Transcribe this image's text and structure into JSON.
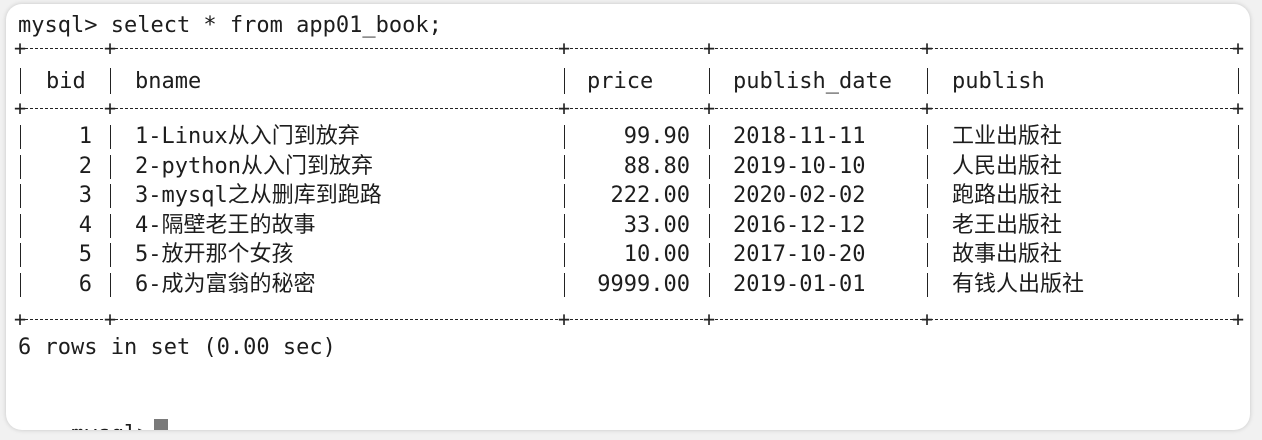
{
  "terminal": {
    "command_prompt": "mysql> select * from app01_book;",
    "prompt": "mysql>",
    "summary": "6 rows in set (0.00 sec)"
  },
  "table": {
    "columns": [
      "bid",
      "bname",
      "price",
      "publish_date",
      "publish"
    ],
    "rows": [
      {
        "bid": "1",
        "bname": "1-Linux从入门到放弃",
        "price": "99.90",
        "publish_date": "2018-11-11",
        "publish": "工业出版社"
      },
      {
        "bid": "2",
        "bname": "2-python从入门到放弃",
        "price": "88.80",
        "publish_date": "2019-10-10",
        "publish": "人民出版社"
      },
      {
        "bid": "3",
        "bname": "3-mysql之从删库到跑路",
        "price": "222.00",
        "publish_date": "2020-02-02",
        "publish": "跑路出版社"
      },
      {
        "bid": "4",
        "bname": "4-隔壁老王的故事",
        "price": "33.00",
        "publish_date": "2016-12-12",
        "publish": "老王出版社"
      },
      {
        "bid": "5",
        "bname": "5-放开那个女孩",
        "price": "10.00",
        "publish_date": "2017-10-20",
        "publish": "故事出版社"
      },
      {
        "bid": "6",
        "bname": "6-成为富翁的秘密",
        "price": "9999.00",
        "publish_date": "2019-01-01",
        "publish": "有钱人出版社"
      }
    ]
  }
}
